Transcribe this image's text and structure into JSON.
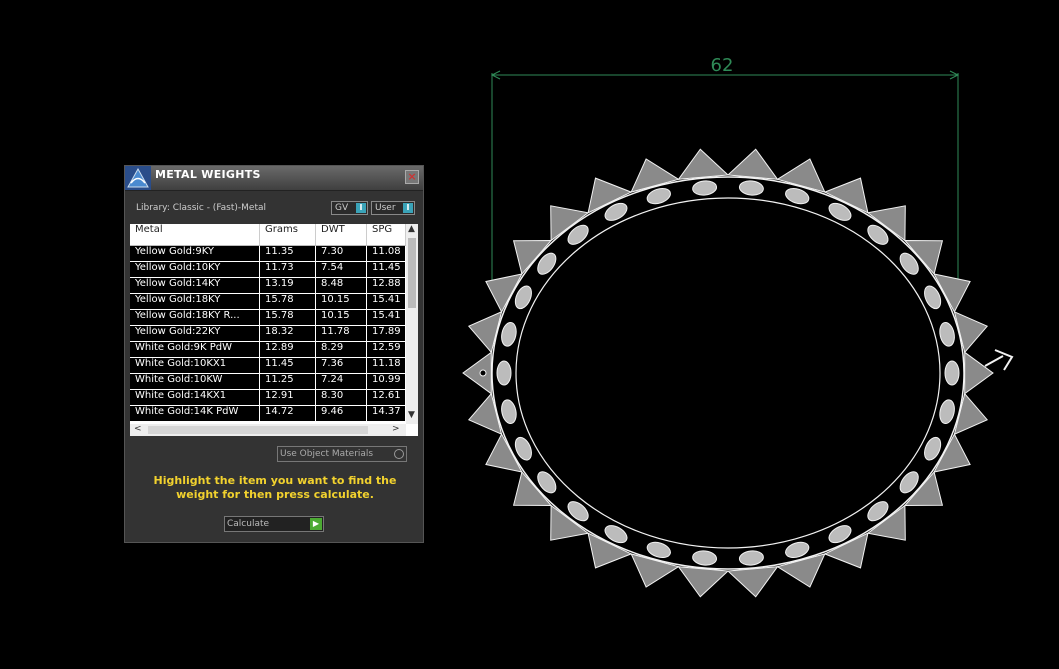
{
  "viewport": {
    "dimension_value": "62",
    "dimension_color": "#2f8a57",
    "wire_color": "#f2f2f2"
  },
  "panel": {
    "title": "METAL WEIGHTS",
    "close_icon": "close-x-icon",
    "library_label": "Library: Classic - (Fast)-Metal",
    "toggle_gv": "GV",
    "toggle_user": "User",
    "table": {
      "columns": [
        "Metal",
        "Grams",
        "DWT",
        "SPG"
      ],
      "rows": [
        [
          "Yellow Gold:9KY",
          "11.35",
          "7.30",
          "11.08"
        ],
        [
          "Yellow Gold:10KY",
          "11.73",
          "7.54",
          "11.45"
        ],
        [
          "Yellow Gold:14KY",
          "13.19",
          "8.48",
          "12.88"
        ],
        [
          "Yellow Gold:18KY",
          "15.78",
          "10.15",
          "15.41"
        ],
        [
          "Yellow Gold:18KY R...",
          "15.78",
          "10.15",
          "15.41"
        ],
        [
          "Yellow Gold:22KY",
          "18.32",
          "11.78",
          "17.89"
        ],
        [
          "White Gold:9K PdW",
          "12.89",
          "8.29",
          "12.59"
        ],
        [
          "White Gold:10KX1",
          "11.45",
          "7.36",
          "11.18"
        ],
        [
          "White Gold:10KW",
          "11.25",
          "7.24",
          "10.99"
        ],
        [
          "White Gold:14KX1",
          "12.91",
          "8.30",
          "12.61"
        ],
        [
          "White Gold:14K PdW",
          "14.72",
          "9.46",
          "14.37"
        ]
      ]
    },
    "use_object_materials": "Use Object Materials",
    "instructions": "Highlight the item you want to find the weight for then press calculate.",
    "calculate_label": "Calculate",
    "accent_color": "#f2d22e",
    "led_color": "#3aa3b8"
  }
}
